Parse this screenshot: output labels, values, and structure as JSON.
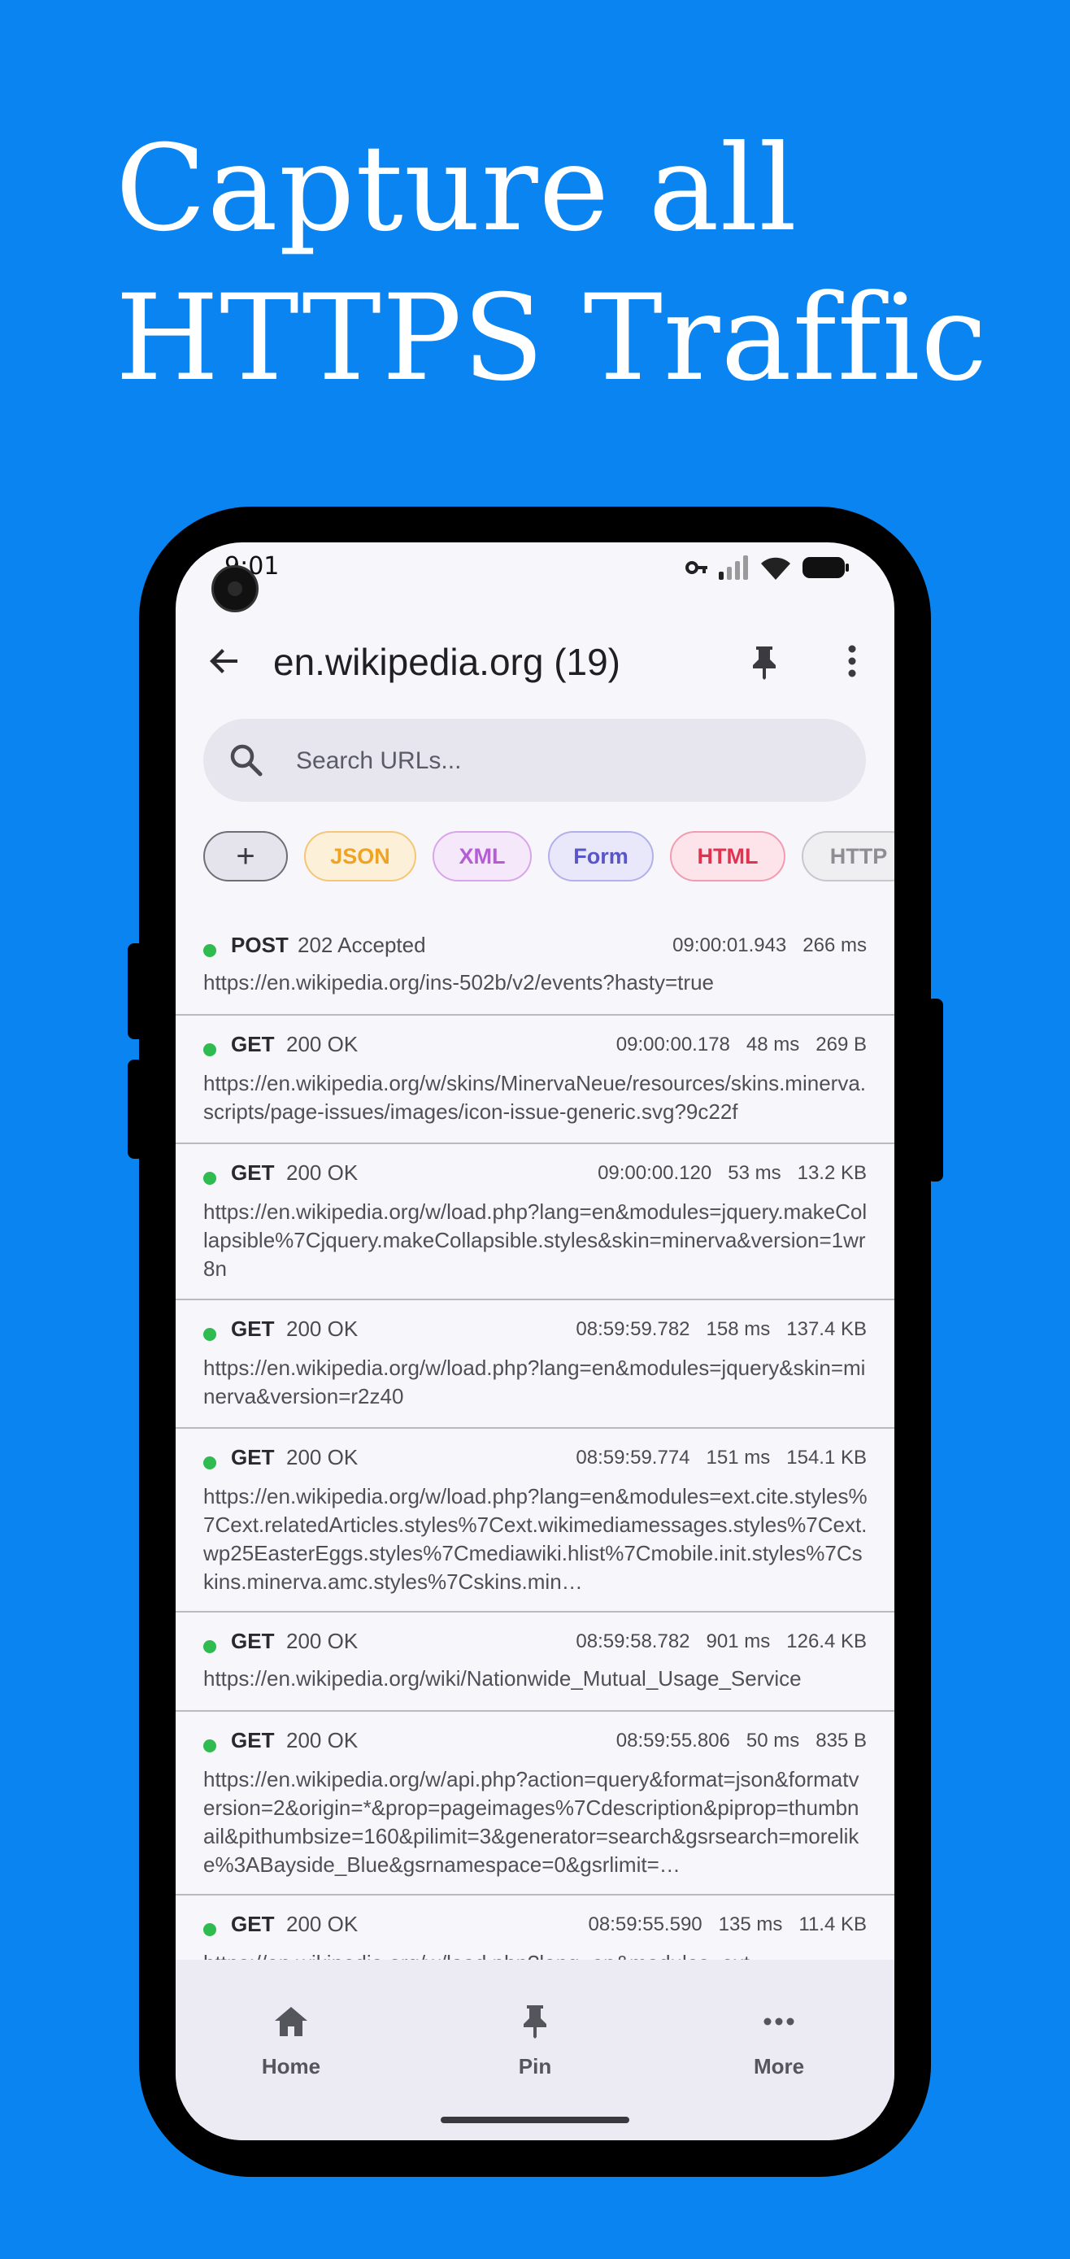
{
  "headline": {
    "line1": "Capture all",
    "line2": "HTTPS Traffic"
  },
  "status_bar": {
    "time": "9:01",
    "icons": [
      "vpn-key-icon",
      "signal-icon",
      "wifi-icon",
      "battery-icon"
    ]
  },
  "app_bar": {
    "title": "en.wikipedia.org (19)",
    "icons": [
      "back-arrow-icon",
      "pin-icon",
      "more-vert-icon"
    ]
  },
  "search": {
    "placeholder": "Search URLs...",
    "value": ""
  },
  "filters": {
    "add_label": "+",
    "chips": [
      {
        "label": "JSON",
        "color": "#f0a321"
      },
      {
        "label": "XML",
        "color": "#b45ed6"
      },
      {
        "label": "Form",
        "color": "#5956c9"
      },
      {
        "label": "HTML",
        "color": "#e0334f"
      },
      {
        "label": "HTTP",
        "color": "#8d8d94"
      }
    ]
  },
  "requests": [
    {
      "method": "POST",
      "status": "202 Accepted",
      "time": "09:00:01.943",
      "duration": "266 ms",
      "size": "",
      "url": "https://en.wikipedia.org/ins-502b/v2/events?hasty=true"
    },
    {
      "method": "GET",
      "status": "200 OK",
      "time": "09:00:00.178",
      "duration": "48 ms",
      "size": "269 B",
      "url": "https://en.wikipedia.org/w/skins/MinervaNeue/resources/skins.minerva.scripts/page-issues/images/icon-issue-generic.svg?9c22f"
    },
    {
      "method": "GET",
      "status": "200 OK",
      "time": "09:00:00.120",
      "duration": "53 ms",
      "size": "13.2 KB",
      "url": "https://en.wikipedia.org/w/load.php?lang=en&modules=jquery.makeCollapsible%7Cjquery.makeCollapsible.styles&skin=minerva&version=1wr8n"
    },
    {
      "method": "GET",
      "status": "200 OK",
      "time": "08:59:59.782",
      "duration": "158 ms",
      "size": "137.4 KB",
      "url": "https://en.wikipedia.org/w/load.php?lang=en&modules=jquery&skin=minerva&version=r2z40"
    },
    {
      "method": "GET",
      "status": "200 OK",
      "time": "08:59:59.774",
      "duration": "151 ms",
      "size": "154.1 KB",
      "url": "https://en.wikipedia.org/w/load.php?lang=en&modules=ext.cite.styles%7Cext.relatedArticles.styles%7Cext.wikimediamessages.styles%7Cext.wp25EasterEggs.styles%7Cmediawiki.hlist%7Cmobile.init.styles%7Cskins.minerva.amc.styles%7Cskins.min…"
    },
    {
      "method": "GET",
      "status": "200 OK",
      "time": "08:59:58.782",
      "duration": "901 ms",
      "size": "126.4 KB",
      "url": "https://en.wikipedia.org/wiki/Nationwide_Mutual_Usage_Service"
    },
    {
      "method": "GET",
      "status": "200 OK",
      "time": "08:59:55.806",
      "duration": "50 ms",
      "size": "835 B",
      "url": "https://en.wikipedia.org/w/api.php?action=query&format=json&formatversion=2&origin=*&prop=pageimages%7Cdescription&piprop=thumbnail&pithumbsize=160&pilimit=3&generator=search&gsrsearch=morelike%3ABayside_Blue&gsrnamespace=0&gsrlimit=…"
    },
    {
      "method": "GET",
      "status": "200 OK",
      "time": "08:59:55.590",
      "duration": "135 ms",
      "size": "11.4 KB",
      "url": "https://en.wikipedia.org/w/load.php?lang=en&modules=ext"
    }
  ],
  "bottom_nav": [
    {
      "label": "Home",
      "icon": "home-icon"
    },
    {
      "label": "Pin",
      "icon": "pin-icon"
    },
    {
      "label": "More",
      "icon": "more-horiz-icon"
    }
  ]
}
